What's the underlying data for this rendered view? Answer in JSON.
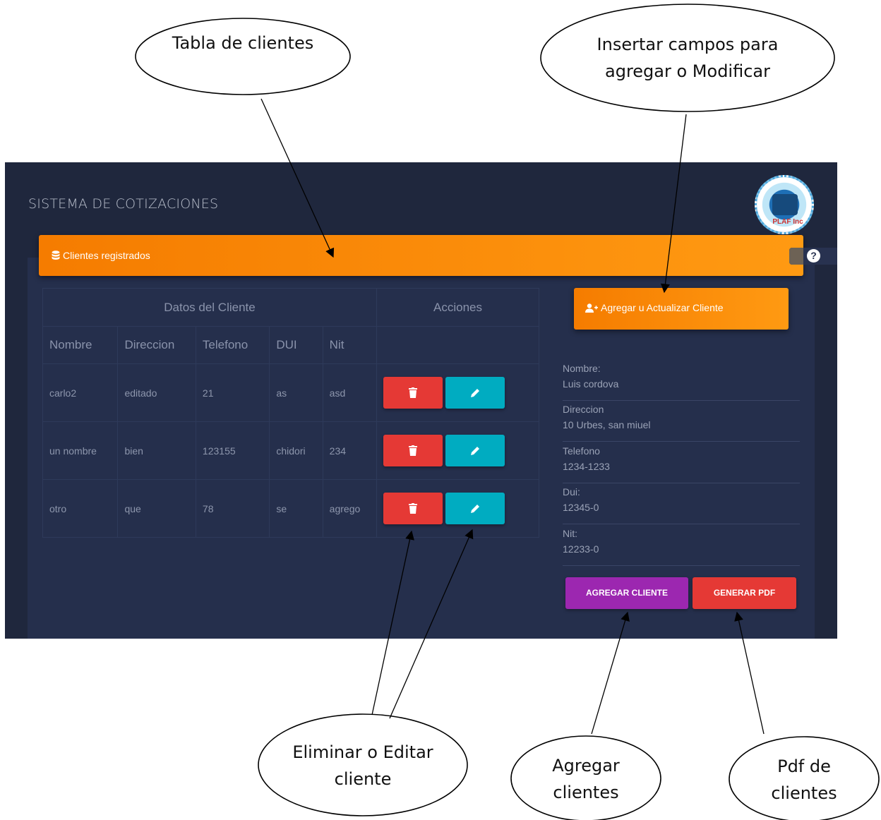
{
  "annotations": {
    "tabla": "Tabla de clientes",
    "insertar": "Insertar campos para agregar o Modificar",
    "eliminar": "Eliminar o Editar cliente",
    "agregar": "Agregar clientes",
    "pdf": "Pdf de clientes"
  },
  "app": {
    "title": "SISTEMA DE COTIZACIONES",
    "logo_text": "PLAF Inc"
  },
  "panel": {
    "header": "Clientes registrados"
  },
  "table": {
    "group_headers": [
      "Datos del Cliente",
      "Acciones"
    ],
    "columns": [
      "Nombre",
      "Direccion",
      "Telefono",
      "DUI",
      "Nit"
    ],
    "rows": [
      [
        "carlo2",
        "editado",
        "21",
        "as",
        "asd"
      ],
      [
        "un nombre",
        "bien",
        "123155",
        "chidori",
        "234"
      ],
      [
        "otro",
        "que",
        "78",
        "se",
        "agrego"
      ]
    ]
  },
  "form": {
    "add_update_label": "Agregar u Actualizar Cliente",
    "fields": [
      {
        "label": "Nombre:",
        "value": "Luis cordova"
      },
      {
        "label": "Direccion",
        "value": "10 Urbes, san miuel"
      },
      {
        "label": "Telefono",
        "value": "1234-1233"
      },
      {
        "label": "Dui:",
        "value": "12345-0"
      },
      {
        "label": "Nit:",
        "value": "12233-0"
      }
    ],
    "add_button": "AGREGAR CLIENTE",
    "pdf_button": "GENERAR PDF"
  },
  "colors": {
    "background": "#1f273d",
    "accent_orange": "#f57c00",
    "danger_red": "#e53935",
    "edit_cyan": "#00acc1",
    "add_purple": "#9c27b0"
  },
  "icons": [
    "database-icon",
    "help-icon",
    "trash-icon",
    "pencil-icon",
    "user-plus-icon"
  ]
}
